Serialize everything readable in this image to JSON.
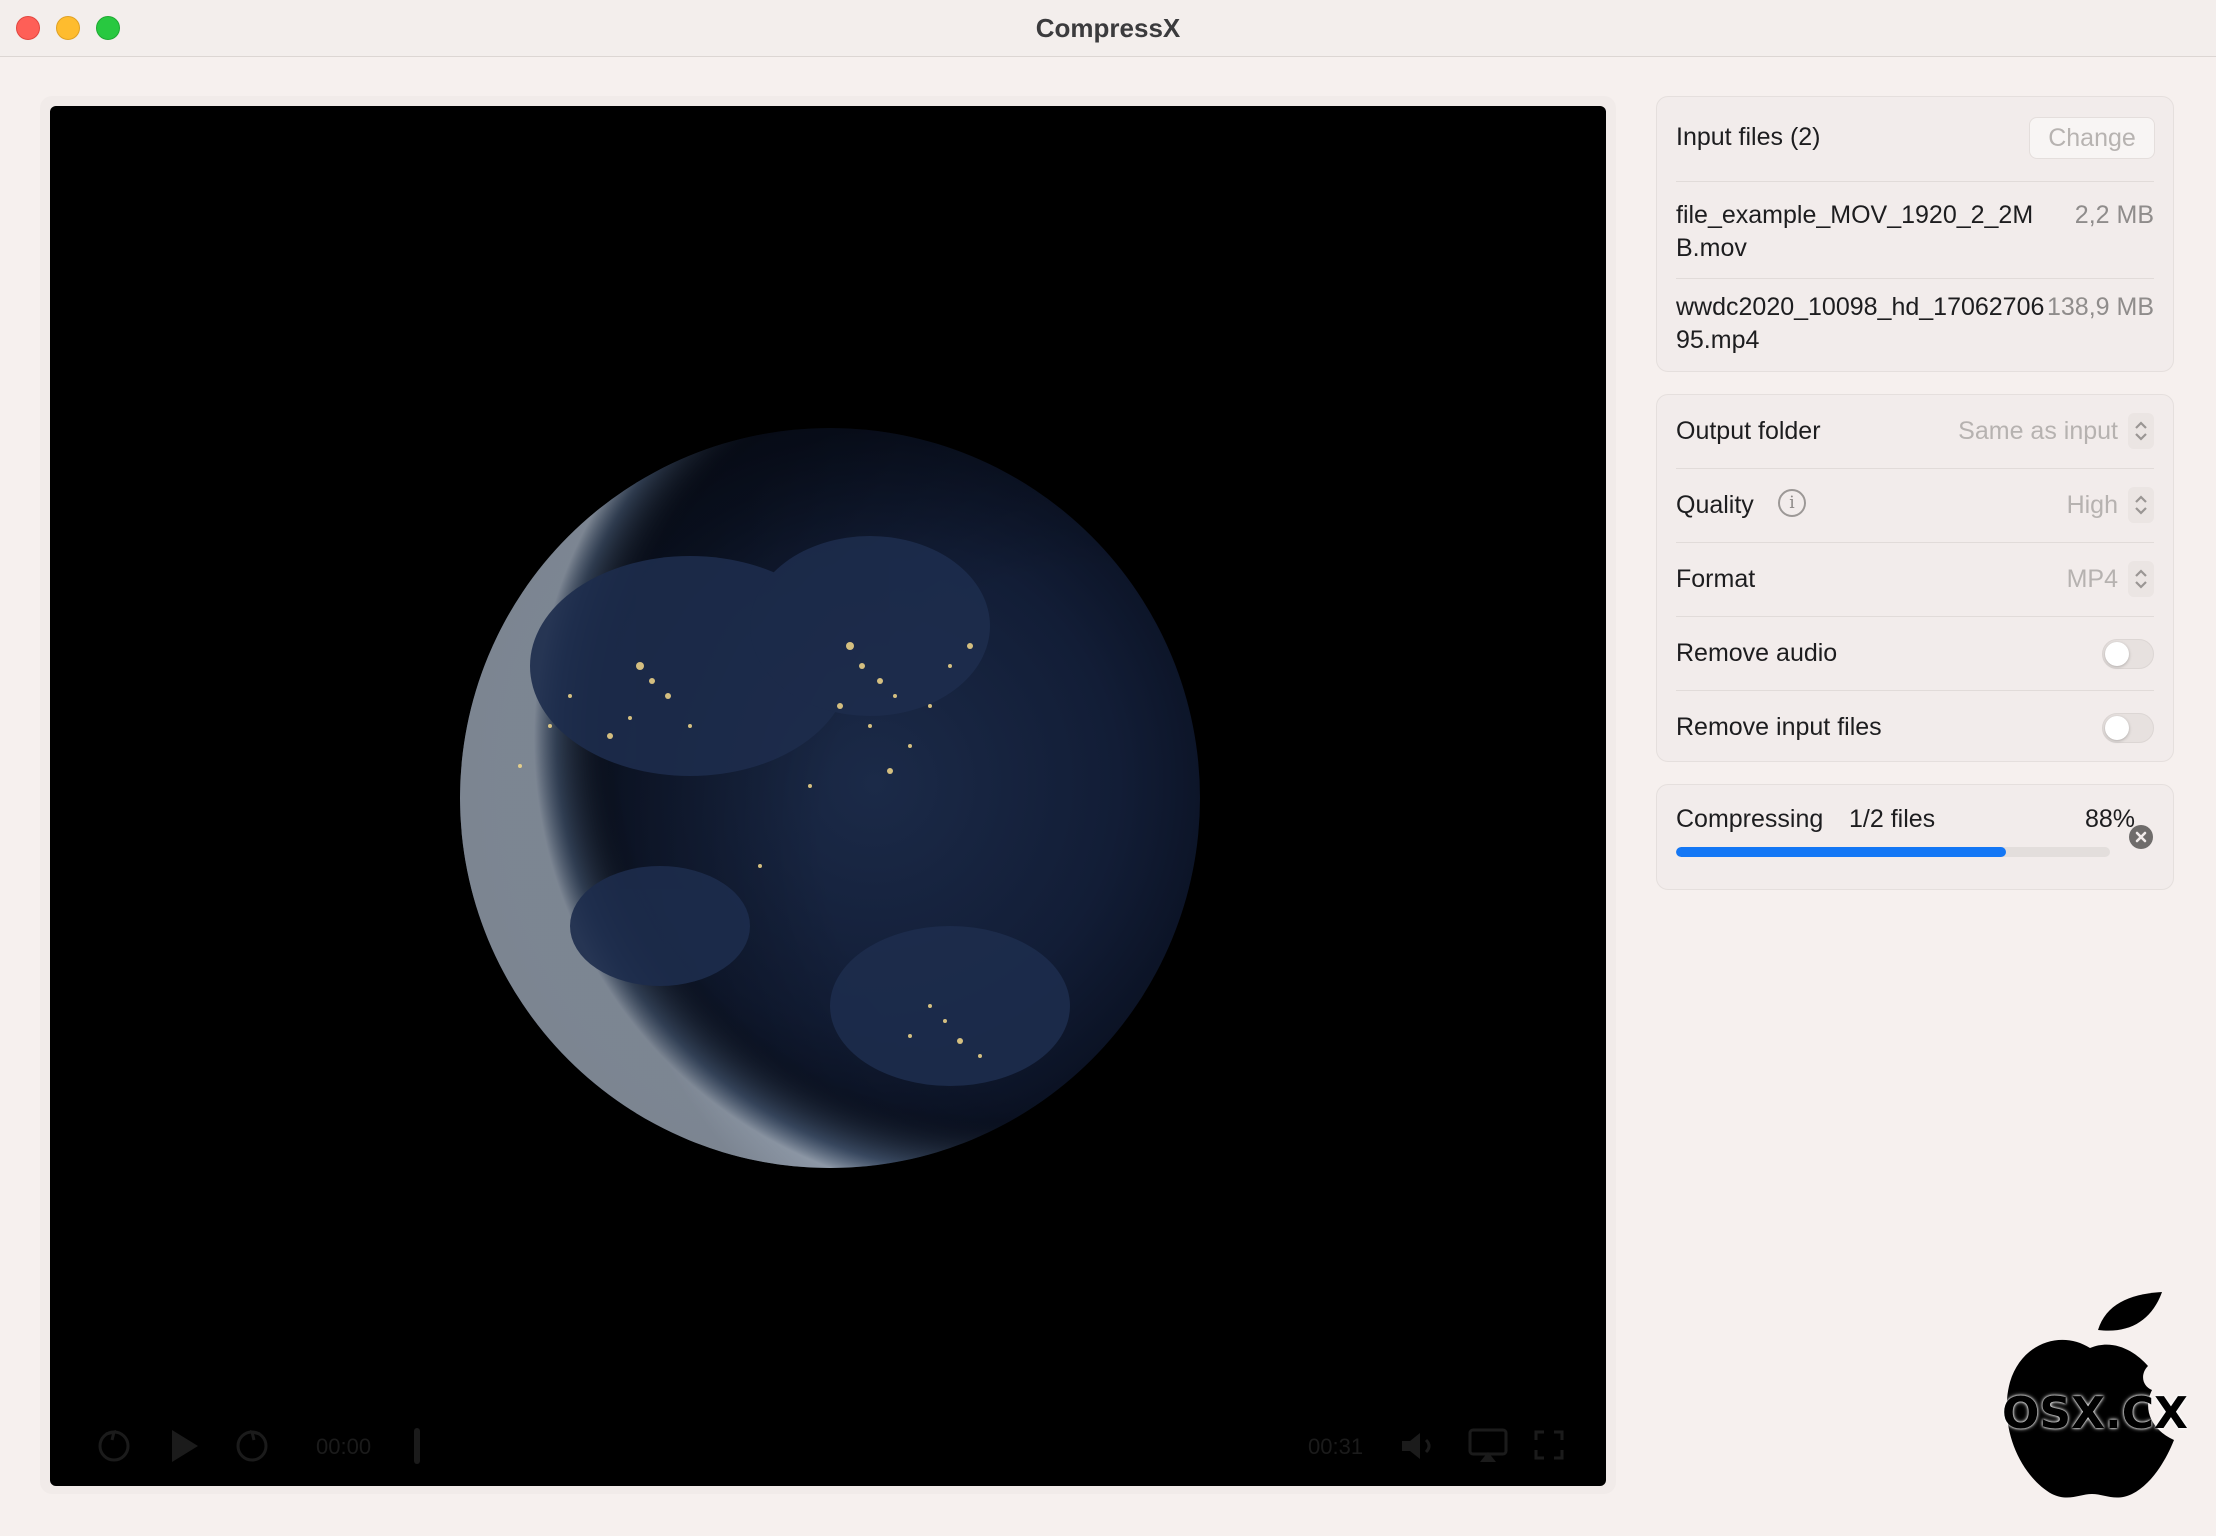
{
  "window": {
    "title": "CompressX"
  },
  "player": {
    "time_elapsed": "00:00",
    "time_remaining": "00:31",
    "skip_back_label": "15",
    "skip_forward_label": "15"
  },
  "input_files": {
    "header": "Input files (2)",
    "change_label": "Change",
    "files": [
      {
        "name": "file_example_MOV_1920_2_2MB.mov",
        "size": "2,2 MB"
      },
      {
        "name": "wwdc2020_10098_hd_1706270695.mp4",
        "size": "138,9 MB"
      }
    ]
  },
  "settings": {
    "output_folder": {
      "label": "Output folder",
      "value": "Same as input"
    },
    "quality": {
      "label": "Quality",
      "value": "High"
    },
    "format": {
      "label": "Format",
      "value": "MP4"
    },
    "remove_audio": {
      "label": "Remove audio",
      "enabled": false
    },
    "remove_input_files": {
      "label": "Remove input files",
      "enabled": false
    }
  },
  "progress": {
    "label": "Compressing",
    "count": "1/2 files",
    "percent_label": "88%",
    "fraction": 0.76,
    "color": "#1477f5"
  },
  "watermark": {
    "text": "OSX.CX"
  },
  "icons": {
    "info": "info-icon",
    "stepper": "up-down-chevron-icon",
    "cancel": "cancel-icon"
  }
}
